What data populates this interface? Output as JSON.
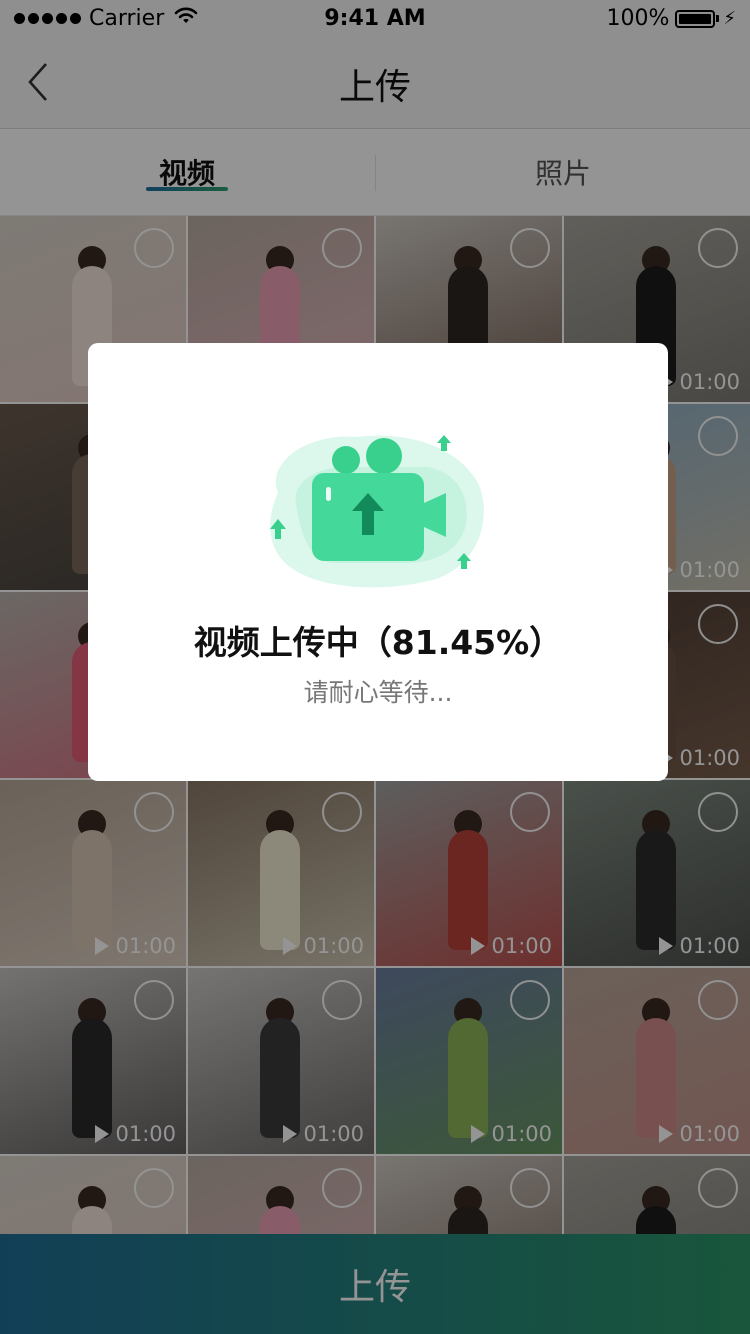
{
  "status_bar": {
    "carrier": "Carrier",
    "time": "9:41 AM",
    "battery": "100%"
  },
  "nav": {
    "title": "上传"
  },
  "tabs": [
    {
      "label": "视频",
      "active": true
    },
    {
      "label": "照片",
      "active": false
    }
  ],
  "grid": {
    "items": [
      {
        "bg": "#d9d2c9",
        "accent": "#e8c8c0",
        "duration": "",
        "figure": "#f3e4dc"
      },
      {
        "bg": "#b9ada2",
        "accent": "#f0b6c5",
        "duration": "",
        "figure": "#ed9fb7"
      },
      {
        "bg": "#cfcac4",
        "accent": "#5a3d2f",
        "duration": "",
        "figure": "#2d2724"
      },
      {
        "bg": "#a7a49c",
        "accent": "#6e6b66",
        "duration": "01:00",
        "figure": "#1d1d1d"
      },
      {
        "bg": "#6a5a4d",
        "accent": "#3a3a3a",
        "duration": "",
        "figure": "#7a6a5c"
      },
      {
        "bg": "#d7d5d1",
        "accent": "#a6a19a",
        "duration": "",
        "figure": "#c7b6a6"
      },
      {
        "bg": "#d4d0cc",
        "accent": "#8e8a86",
        "duration": "",
        "figure": "#e7d0c8"
      },
      {
        "bg": "#8fb0c7",
        "accent": "#d8c4a6",
        "duration": "01:00",
        "figure": "#c6a289"
      },
      {
        "bg": "#b8b3ad",
        "accent": "#e15a73",
        "duration": "",
        "figure": "#e35d77"
      },
      {
        "bg": "#cbc3bb",
        "accent": "#9e9187",
        "duration": "",
        "figure": "#bba99b"
      },
      {
        "bg": "#c2beb8",
        "accent": "#8c857d",
        "duration": "",
        "figure": "#b59c8a"
      },
      {
        "bg": "#4e3e35",
        "accent": "#8a6b55",
        "duration": "01:00",
        "figure": "#6b5243"
      },
      {
        "bg": "#b8a999",
        "accent": "#e9ddd0",
        "duration": "01:00",
        "figure": "#d9c6b3"
      },
      {
        "bg": "#8a7866",
        "accent": "#e8e2cf",
        "duration": "01:00",
        "figure": "#f1ead3"
      },
      {
        "bg": "#a1a3a2",
        "accent": "#c8322f",
        "duration": "01:00",
        "figure": "#b8423c"
      },
      {
        "bg": "#7f8a80",
        "accent": "#3b3b3b",
        "duration": "01:00",
        "figure": "#2b2b2b"
      },
      {
        "bg": "#c7c5c2",
        "accent": "#3c3a3a",
        "duration": "01:00",
        "figure": "#2a2a2a"
      },
      {
        "bg": "#cbc9c6",
        "accent": "#4b4846",
        "duration": "01:00",
        "figure": "#3b3b3b"
      },
      {
        "bg": "#6b7ea0",
        "accent": "#66a04b",
        "duration": "01:00",
        "figure": "#8db65a"
      },
      {
        "bg": "#b9a79a",
        "accent": "#c98c86",
        "duration": "01:00",
        "figure": "#d18b8a"
      },
      {
        "bg": "#d9d2c9",
        "accent": "#e8c8c0",
        "duration": "",
        "figure": "#f3e4dc"
      },
      {
        "bg": "#b9ada2",
        "accent": "#f0b6c5",
        "duration": "",
        "figure": "#ed9fb7"
      },
      {
        "bg": "#cfcac4",
        "accent": "#5a3d2f",
        "duration": "",
        "figure": "#2d2724"
      },
      {
        "bg": "#a7a49c",
        "accent": "#6e6b66",
        "duration": "",
        "figure": "#1d1d1d"
      }
    ]
  },
  "dialog": {
    "title": "视频上传中（81.45%）",
    "subtitle": "请耐心等待...",
    "progress_percent": 81.45,
    "illustration_icon": "video-camera-upload-icon"
  },
  "footer": {
    "upload_label": "上传"
  },
  "colors": {
    "accent_start": "#1f6d95",
    "accent_end": "#2b9567",
    "illustration_green": "#3fd39a"
  }
}
